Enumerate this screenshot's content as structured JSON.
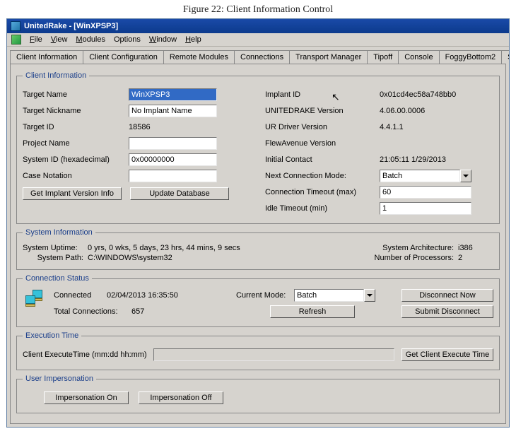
{
  "caption": "Figure 22: Client Information Control",
  "titlebar": "UnitedRake - [WinXPSP3]",
  "menu": {
    "file": "File",
    "view": "View",
    "modules": "Modules",
    "options": "Options",
    "window": "Window",
    "help": "Help"
  },
  "tabs": {
    "client_information": "Client Information",
    "client_configuration": "Client Configuration",
    "remote_modules": "Remote Modules",
    "connections": "Connections",
    "transport_manager": "Transport Manager",
    "tipoff": "Tipoff",
    "console": "Console",
    "foggybottom2": "FoggyBottom2",
    "salv": "Salv"
  },
  "client_info": {
    "legend": "Client Information",
    "left": {
      "target_name": {
        "label": "Target Name",
        "value": "WinXPSP3"
      },
      "target_nickname": {
        "label": "Target Nickname",
        "value": "No Implant Name"
      },
      "target_id": {
        "label": "Target ID",
        "value": "18586"
      },
      "project_name": {
        "label": "Project Name",
        "value": ""
      },
      "system_id": {
        "label": "System ID (hexadecimal)",
        "value": "0x00000000"
      },
      "case_notation": {
        "label": "Case Notation",
        "value": ""
      },
      "btn_get_version": "Get Implant Version Info",
      "btn_update_db": "Update Database"
    },
    "right": {
      "implant_id": {
        "label": "Implant ID",
        "value": "0x01cd4ec58a748bb0"
      },
      "ur_version": {
        "label": "UNITEDRAKE Version",
        "value": "4.06.00.0006"
      },
      "ur_driver": {
        "label": "UR Driver Version",
        "value": "4.4.1.1"
      },
      "flewavenue": {
        "label": "FlewAvenue Version",
        "value": ""
      },
      "initial_contact": {
        "label": "Initial Contact",
        "value": "21:05:11  1/29/2013"
      },
      "next_conn_mode": {
        "label": "Next Connection Mode:",
        "value": "Batch"
      },
      "conn_timeout": {
        "label": "Connection Timeout (max)",
        "value": "60"
      },
      "idle_timeout": {
        "label": "Idle Timeout (min)",
        "value": "1"
      }
    }
  },
  "system_info": {
    "legend": "System Information",
    "uptime_label": "System Uptime:",
    "uptime_value": "0 yrs, 0 wks, 5 days, 23 hrs, 44 mins, 9 secs",
    "path_label": "System Path:",
    "path_value": "C:\\WINDOWS\\system32",
    "arch_label": "System Architecture:",
    "arch_value": "i386",
    "cpus_label": "Number of Processors:",
    "cpus_value": "2"
  },
  "conn_status": {
    "legend": "Connection Status",
    "status": "Connected",
    "timestamp": "02/04/2013 16:35:50",
    "total_conn_label": "Total Connections:",
    "total_conn_value": "657",
    "current_mode_label": "Current Mode:",
    "current_mode_value": "Batch",
    "btn_disconnect": "Disconnect Now",
    "btn_refresh": "Refresh",
    "btn_submit": "Submit Disconnect"
  },
  "exec_time": {
    "legend": "Execution Time",
    "label": "Client ExecuteTime (mm:dd hh:mm)",
    "btn": "Get Client Execute Time"
  },
  "user_imp": {
    "legend": "User Impersonation",
    "btn_on": "Impersonation On",
    "btn_off": "Impersonation Off"
  }
}
